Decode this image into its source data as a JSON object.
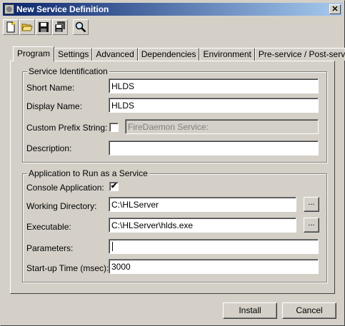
{
  "window": {
    "title": "New Service Definition",
    "close_label": "✕"
  },
  "toolbar": {
    "buttons": [
      {
        "name": "new",
        "icon": "new-document-icon"
      },
      {
        "name": "open",
        "icon": "open-folder-icon"
      },
      {
        "name": "save",
        "icon": "save-disk-icon"
      },
      {
        "name": "save-all",
        "icon": "save-all-icon"
      },
      {
        "name": "find",
        "icon": "magnifier-icon"
      }
    ]
  },
  "tabs": [
    "Program",
    "Settings",
    "Advanced",
    "Dependencies",
    "Environment",
    "Pre-service / Post-service"
  ],
  "service_identification": {
    "title": "Service Identification",
    "short_name_label": "Short Name:",
    "short_name_value": "HLDS",
    "display_name_label": "Display Name:",
    "display_name_value": "HLDS",
    "custom_prefix_label": "Custom Prefix String:",
    "custom_prefix_checked": false,
    "custom_prefix_value": "FireDaemon Service:",
    "description_label": "Description:",
    "description_value": ""
  },
  "application": {
    "title": "Application to Run as a Service",
    "console_app_label": "Console Application:",
    "console_app_checked": "✔",
    "working_dir_label": "Working Directory:",
    "working_dir_value": "C:\\HLServer",
    "executable_label": "Executable:",
    "executable_value": "C:\\HLServer\\hlds.exe",
    "parameters_label": "Parameters:",
    "parameters_value": "",
    "startup_time_label": "Start-up Time (msec):",
    "startup_time_value": "3000",
    "browse_label": "..."
  },
  "buttons": {
    "install": "Install",
    "cancel": "Cancel"
  }
}
